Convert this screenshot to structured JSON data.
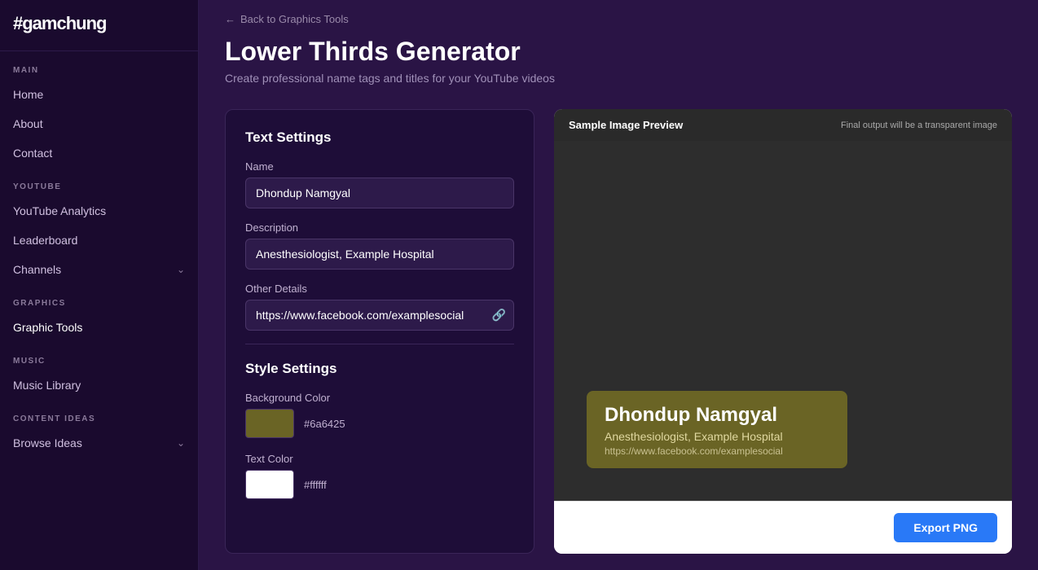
{
  "logo": {
    "text": "#gamchung"
  },
  "sidebar": {
    "sections": [
      {
        "label": "MAIN",
        "items": [
          {
            "id": "home",
            "label": "Home",
            "hasChevron": false
          },
          {
            "id": "about",
            "label": "About",
            "hasChevron": false
          },
          {
            "id": "contact",
            "label": "Contact",
            "hasChevron": false
          }
        ]
      },
      {
        "label": "YOUTUBE",
        "items": [
          {
            "id": "youtube-analytics",
            "label": "YouTube Analytics",
            "hasChevron": false
          },
          {
            "id": "leaderboard",
            "label": "Leaderboard",
            "hasChevron": false
          },
          {
            "id": "channels",
            "label": "Channels",
            "hasChevron": true
          }
        ]
      },
      {
        "label": "GRAPHICS",
        "items": [
          {
            "id": "graphic-tools",
            "label": "Graphic Tools",
            "hasChevron": false
          }
        ]
      },
      {
        "label": "MUSIC",
        "items": [
          {
            "id": "music-library",
            "label": "Music Library",
            "hasChevron": false
          }
        ]
      },
      {
        "label": "CONTENT IDEAS",
        "items": [
          {
            "id": "browse-ideas",
            "label": "Browse Ideas",
            "hasChevron": true
          }
        ]
      }
    ]
  },
  "topbar": {
    "back_label": "Back to Graphics Tools",
    "page_title": "Lower Thirds Generator",
    "page_subtitle": "Create professional name tags and titles for your YouTube videos"
  },
  "left_panel": {
    "text_settings_title": "Text Settings",
    "name_label": "Name",
    "name_value": "Dhondup Namgyal",
    "description_label": "Description",
    "description_value": "Anesthesiologist, Example Hospital",
    "other_details_label": "Other Details",
    "other_details_value": "https://www.facebook.com/examplesocial",
    "style_settings_title": "Style Settings",
    "background_color_label": "Background Color",
    "background_color_hex": "#6a6425",
    "background_color_value": "#6a6425",
    "text_color_label": "Text Color",
    "text_color_hex": "#ffffff",
    "text_color_value": "#ffffff"
  },
  "preview": {
    "header_title": "Sample Image Preview",
    "header_note": "Final output will be a transparent image",
    "lt_name": "Dhondup Namgyal",
    "lt_desc": "Anesthesiologist, Example Hospital",
    "lt_details": "https://www.facebook.com/examplesocial",
    "export_label": "Export PNG"
  }
}
